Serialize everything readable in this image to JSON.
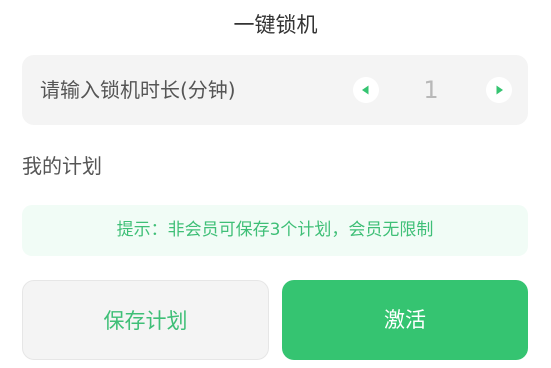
{
  "dialog": {
    "title": "一键锁机"
  },
  "duration": {
    "placeholder": "请输入锁机时长(分钟)",
    "value": "1",
    "decrement_icon": "triangle-left-icon",
    "increment_icon": "triangle-right-icon"
  },
  "plans": {
    "section_title": "我的计划",
    "tip": "提示：非会员可保存3个计划，会员无限制"
  },
  "actions": {
    "save_label": "保存计划",
    "activate_label": "激活"
  },
  "colors": {
    "accent": "#35c471",
    "accent_text": "#3fbf77",
    "tip_bg": "#f1fcf6",
    "card_bg": "#f4f4f4"
  }
}
